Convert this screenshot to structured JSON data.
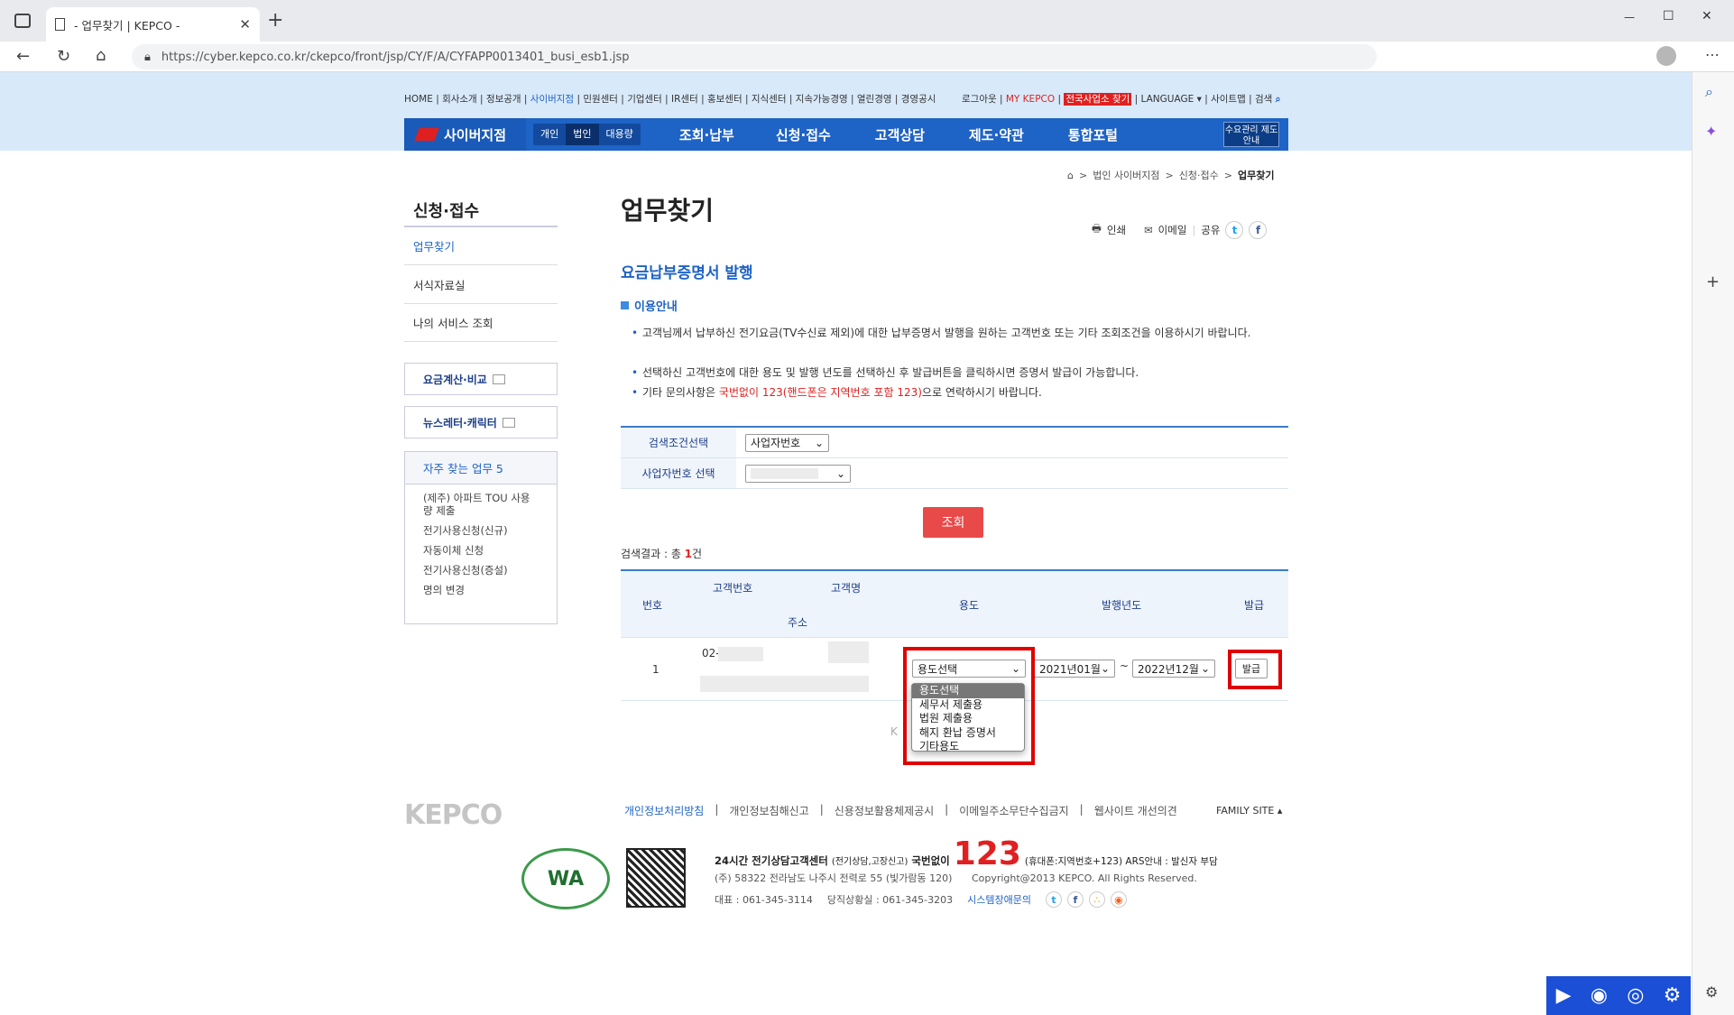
{
  "browser": {
    "tab_title": "- 업무찾기 | KEPCO -",
    "tab_close": "✕",
    "new_tab": "+",
    "url": "https://cyber.kepco.co.kr/ckepco/front/jsp/CY/F/A/CYFAPP0013401_busi_esb1.jsp",
    "window_controls": [
      "—",
      "☐",
      "✕"
    ]
  },
  "util_nav": {
    "left": [
      "HOME",
      "회사소개",
      "정보공개",
      "사이버지점",
      "민원센터",
      "기업센터",
      "IR센터",
      "홍보센터",
      "지식센터",
      "지속가능경영",
      "열린경영",
      "경영공시"
    ],
    "active": "사이버지점",
    "logout": "로그아웃",
    "my_kepco": "MY KEPCO",
    "find_office": "전국사업소 찾기",
    "language": "LANGUAGE",
    "sitemap": "사이트맵",
    "search": "검색"
  },
  "gnb": {
    "brand": "사이버지점",
    "segments": [
      "개인",
      "법인",
      "대용량"
    ],
    "active_segment": "법인",
    "menus": [
      "조회·납부",
      "신청·접수",
      "고객상담",
      "제도·약관",
      "통합포털"
    ],
    "guide": "수요관리 제도안내"
  },
  "lnb": {
    "title": "신청·접수",
    "items": [
      "업무찾기",
      "서식자료실",
      "나의 서비스 조회"
    ],
    "active": "업무찾기",
    "box1": "요금계산·비교",
    "box2": "뉴스레터·캐릭터",
    "freq_title": "자주 찾는 업무 5",
    "freq_items": [
      "(제주) 아파트 TOU 사용량 제출",
      "전기사용신청(신규)",
      "자동이체 신청",
      "전기사용신청(증설)",
      "명의 변경"
    ]
  },
  "breadcrumb": [
    "법인 사이버지점",
    "신청·접수",
    "업무찾기"
  ],
  "page_title": "업무찾기",
  "tools": {
    "print": "인쇄",
    "email": "이메일",
    "share": "공유"
  },
  "subtitle": "요금납부증명서 발행",
  "section_title": "이용안내",
  "guide": {
    "line1": "고객님께서 납부하신 전기요금(TV수신료 제외)에 대한 납부증명서 발행을 원하는 고객번호 또는 기타 조회조건을 이용하시기 바랍니다.",
    "line2": "선택하신 고객번호에 대한 용도 및 발행 년도를 선택하신 후 발급버튼을 클릭하시면 증명서 발급이 가능합니다.",
    "line3_pre": "기타 문의사항은 ",
    "line3_red": "국번없이 123(핸드폰은 지역번호 포함 123)",
    "line3_post": "으로 연락하시기 바랍니다."
  },
  "search": {
    "cond_label": "검색조건선택",
    "cond_value": "사업자번호",
    "biz_label": "사업자번호 선택",
    "biz_value": "",
    "button": "조회"
  },
  "result": {
    "prefix": "검색결과 : 총 ",
    "count": "1",
    "suffix": "건"
  },
  "table": {
    "headers": {
      "no": "번호",
      "cust_no": "고객번호",
      "cust_name": "고객명",
      "addr": "주소",
      "usage": "용도",
      "year": "발행년도",
      "issue": "발급"
    },
    "row": {
      "no": "1",
      "cust_no_prefix": "02-",
      "usage_selected": "용도선택",
      "year_from": "2021년01월",
      "year_sep": "~",
      "year_to": "2022년12월",
      "issue_btn": "발급"
    },
    "usage_options": [
      "용도선택",
      "세무서 제출용",
      "법원 제출용",
      "해지 환납 증명서",
      "기타용도"
    ]
  },
  "footer": {
    "links": [
      "개인정보처리방침",
      "개인정보침해신고",
      "신용정보활용체제공시",
      "이메일주소무단수집금지",
      "웹사이트 개선의견"
    ],
    "family_site": "FAMILY SITE",
    "logo": "KEPCO",
    "wa": "WA",
    "call_center": "24시간 전기상담고객센터",
    "call_sub": "(전기상담,고장신고)",
    "no_area": "국번없이",
    "number": "123",
    "number_note": "(휴대폰:지역번호+123) ARS안내 : 발신자 부담",
    "address": "(주) 58322 전라남도 나주시 전력로 55 (빛가람동 120)",
    "copyright": "Copyright@2013 KEPCO. All Rights Reserved.",
    "tel": "대표 : 061-345-3114",
    "duty": "당직상황실 : 061-345-3203",
    "sys_err": "시스템장애문의"
  }
}
